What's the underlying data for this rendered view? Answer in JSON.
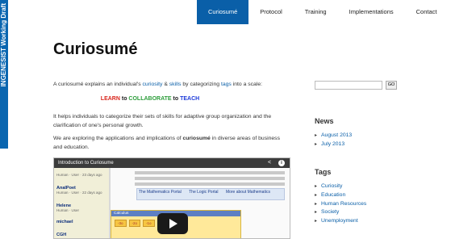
{
  "banner": {
    "text": "INGENESIST Working Draft"
  },
  "nav": {
    "items": [
      {
        "label": "Curiosumé",
        "active": true
      },
      {
        "label": "Protocol"
      },
      {
        "label": "Training"
      },
      {
        "label": "Implementations"
      },
      {
        "label": "Contact"
      }
    ]
  },
  "page": {
    "title": "Curiosumé",
    "intro": {
      "pre": "A curiosumé explains an individual's ",
      "link1": "curiosity",
      "amp": " & ",
      "link2": "skills",
      "mid": " by categorizing ",
      "link3": "tags",
      "post": " into a scale:"
    },
    "scale": {
      "learn": "LEARN",
      "to1": " to ",
      "collaborate": "COLLABORATE",
      "to2": " to ",
      "teach": "TEACH"
    },
    "para2": "It helps individuals to categorize their sets of skills for adaptive group organization and the clarification of one's personal growth.",
    "para3_pre": "We are exploring the applications and implications of ",
    "para3_bold": "curiosumé",
    "para3_post": " in diverse areas of business and education."
  },
  "video": {
    "title": "Introduction to Curiosume",
    "users": [
      {
        "name": "AnalPoet",
        "meta": "Human · User · 23 days ago"
      },
      {
        "name": "Helene",
        "meta": "Human · User · 22 days ago"
      },
      {
        "name": "michael",
        "meta": "Human · User"
      },
      {
        "name": "CGH",
        "meta": ""
      }
    ],
    "portal_links": [
      "The Mathematics Portal",
      "The Logic Portal",
      "More about Mathematics"
    ],
    "calc_title": "Calculus",
    "calc_chips": [
      "-3o",
      "-2o",
      "-1o"
    ]
  },
  "sidebar": {
    "search_button": "GO",
    "news_heading": "News",
    "news": [
      "August 2013",
      "July 2013"
    ],
    "tags_heading": "Tags",
    "tags": [
      "Curiosity",
      "Education",
      "Human Resources",
      "Society",
      "Unemployment"
    ]
  }
}
